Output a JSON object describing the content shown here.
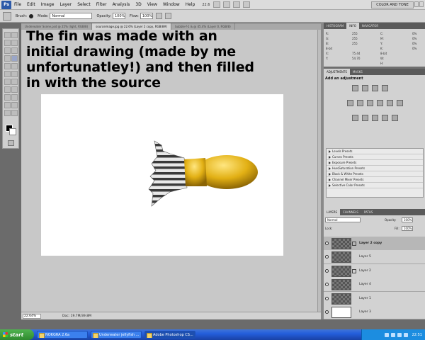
{
  "app": {
    "logo": "Ps",
    "zoom_control": "22.6"
  },
  "menu": [
    "File",
    "Edit",
    "Image",
    "Layer",
    "Select",
    "Filter",
    "Analysis",
    "3D",
    "View",
    "Window",
    "Help"
  ],
  "workspace": "COLOR AND TONE",
  "options_bar": {
    "brush_label": "Brush:",
    "mode_label": "Mode:",
    "mode_value": "Normal",
    "opacity_label": "Opacity:",
    "opacity_value": "100%",
    "flow_label": "Flow:",
    "flow_value": "100%"
  },
  "doc_tabs": [
    {
      "label": "Underwater Scene.psd @ 25% (light, RGB/8)",
      "active": false
    },
    {
      "label": "sourceimage.jpg @ 22.6% (Layer 2 copy, RGB/8#)",
      "active": true
    },
    {
      "label": "bubble-f-1 & @ 45.4% (Layer 0, RGB/8)",
      "active": false
    }
  ],
  "overlay_text": "The fin was made with an initial drawing (made by me unfortunatley!) and then filled in with the source",
  "status": {
    "zoom": "22.64%",
    "doc": "Doc: 19.7M/39.8M"
  },
  "info_panel": {
    "tabs": [
      "HISTOGRAM",
      "INFO",
      "NAVIGATOR"
    ],
    "rows_left": [
      "R:",
      "G:",
      "B:",
      "8-bit",
      "X:",
      "Y:"
    ],
    "values_left": [
      "255",
      "255",
      "255",
      "",
      "75.44",
      "54.70"
    ],
    "rows_right": [
      "C:",
      "M:",
      "Y:",
      "K:",
      "8-bit",
      "W:",
      "H:"
    ],
    "values_right": [
      "0%",
      "0%",
      "0%",
      "0%",
      "",
      ""
    ]
  },
  "adjustments_panel": {
    "tabs": [
      "ADJUSTMENTS",
      "MASKS"
    ],
    "title": "Add an adjustment",
    "presets": [
      "Levels Presets",
      "Curves Presets",
      "Exposure Presets",
      "Hue/Saturation Presets",
      "Black & White Presets",
      "Channel Mixer Presets",
      "Selective Color Presets"
    ]
  },
  "layers_panel": {
    "tabs": [
      "LAYERS",
      "CHANNELS",
      "PATHS"
    ],
    "blend_mode": "Normal",
    "opacity_label": "Opacity:",
    "opacity_value": "100%",
    "lock_label": "Lock:",
    "fill_label": "Fill:",
    "fill_value": "100%",
    "layers": [
      {
        "name": "Layer 2 copy",
        "selected": true,
        "bold": true,
        "white": false
      },
      {
        "name": "Layer 5",
        "selected": false,
        "bold": false,
        "white": false
      },
      {
        "name": "Layer 2",
        "selected": false,
        "bold": false,
        "white": false
      },
      {
        "name": "Layer 4",
        "selected": false,
        "bold": false,
        "white": false
      },
      {
        "name": "Layer 1",
        "selected": false,
        "bold": false,
        "white": false
      },
      {
        "name": "Layer 3",
        "selected": false,
        "bold": false,
        "white": true
      }
    ]
  },
  "taskbar": {
    "start": "start",
    "tasks": [
      {
        "label": "NOKGRA 2.6a",
        "active": false
      },
      {
        "label": "Underwater jellyfish ...",
        "active": false
      },
      {
        "label": "Adobe Photoshop CS...",
        "active": true
      }
    ],
    "clock": "22:51"
  },
  "colors": {
    "fish_body": "#e8b81a",
    "fin_stripe": "#3a3a3a"
  }
}
